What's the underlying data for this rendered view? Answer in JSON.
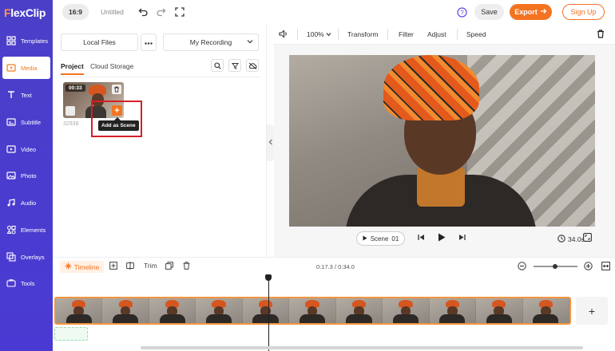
{
  "app": {
    "logo_text": "FlexClip",
    "accent_color": "#f37321",
    "sidebar_color": "#4b3fc8"
  },
  "sidebar": {
    "items": [
      {
        "label": "Templates",
        "icon": "templates-icon"
      },
      {
        "label": "Media",
        "icon": "media-icon",
        "active": true
      },
      {
        "label": "Text",
        "icon": "text-icon"
      },
      {
        "label": "Subtitle",
        "icon": "subtitle-icon"
      },
      {
        "label": "Video",
        "icon": "video-icon"
      },
      {
        "label": "Photo",
        "icon": "photo-icon"
      },
      {
        "label": "Audio",
        "icon": "audio-icon"
      },
      {
        "label": "Elements",
        "icon": "elements-icon"
      },
      {
        "label": "Overlays",
        "icon": "overlays-icon"
      },
      {
        "label": "Tools",
        "icon": "tools-icon"
      }
    ]
  },
  "topbar": {
    "aspect_ratio": "16:9",
    "project_title": "Untitled",
    "save_label": "Save",
    "export_label": "Export",
    "signup_label": "Sign Up"
  },
  "media_panel": {
    "local_files_label": "Local Files",
    "recording_select": "My Recording",
    "tabs": [
      {
        "label": "Project",
        "active": true
      },
      {
        "label": "Cloud Storage"
      }
    ],
    "clip": {
      "duration": "00:33",
      "id": "32938",
      "tooltip": "Add as Scene"
    }
  },
  "editor_toolbar": {
    "zoom": "100%",
    "transform_label": "Transform",
    "filter_label": "Filter",
    "adjust_label": "Adjust",
    "speed_label": "Speed"
  },
  "preview": {
    "scene_label": "Scene",
    "scene_number": "01",
    "duration": "34.0s"
  },
  "timeline": {
    "label": "Timeline",
    "trim_label": "Trim",
    "time": "0:17.3 / 0:34.0"
  }
}
